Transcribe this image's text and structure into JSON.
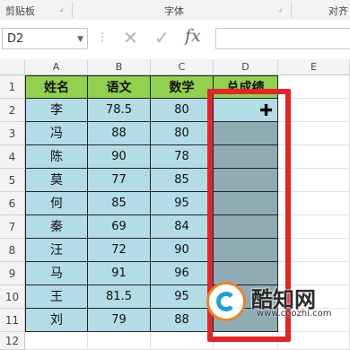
{
  "ribbon": {
    "clipboard_label": "剪贴板",
    "font_label": "字体",
    "align_label": "对齐"
  },
  "formula_bar": {
    "name_box": "D2",
    "cancel_icon": "✕",
    "enter_icon": "✓",
    "fx_label": "fx",
    "formula_value": ""
  },
  "columns": [
    "A",
    "B",
    "C",
    "D",
    "E"
  ],
  "rows": [
    "1",
    "2",
    "3",
    "4",
    "5",
    "6",
    "7",
    "8",
    "9",
    "10",
    "11",
    "12"
  ],
  "table": {
    "headers": [
      "姓名",
      "语文",
      "数学",
      "总成绩"
    ],
    "rows": [
      {
        "name": "李",
        "chinese": "78.5",
        "math": "80"
      },
      {
        "name": "冯",
        "chinese": "88",
        "math": "80"
      },
      {
        "name": "陈",
        "chinese": "90",
        "math": "78"
      },
      {
        "name": "莫",
        "chinese": "77",
        "math": "85"
      },
      {
        "name": "何",
        "chinese": "85",
        "math": "95"
      },
      {
        "name": "秦",
        "chinese": "69",
        "math": "84"
      },
      {
        "name": "汪",
        "chinese": "72",
        "math": "90"
      },
      {
        "name": "马",
        "chinese": "91",
        "math": "96"
      },
      {
        "name": "王",
        "chinese": "81.5",
        "math": "95"
      },
      {
        "name": "刘",
        "chinese": "79",
        "math": "88"
      }
    ]
  },
  "watermark": {
    "brand": "酷知网",
    "url": "www.coozhi.com"
  },
  "colors": {
    "header_fill": "#92d050",
    "data_fill": "#b4dce6",
    "selection_fill": "#8facb4",
    "highlight_border": "#e0262a"
  }
}
